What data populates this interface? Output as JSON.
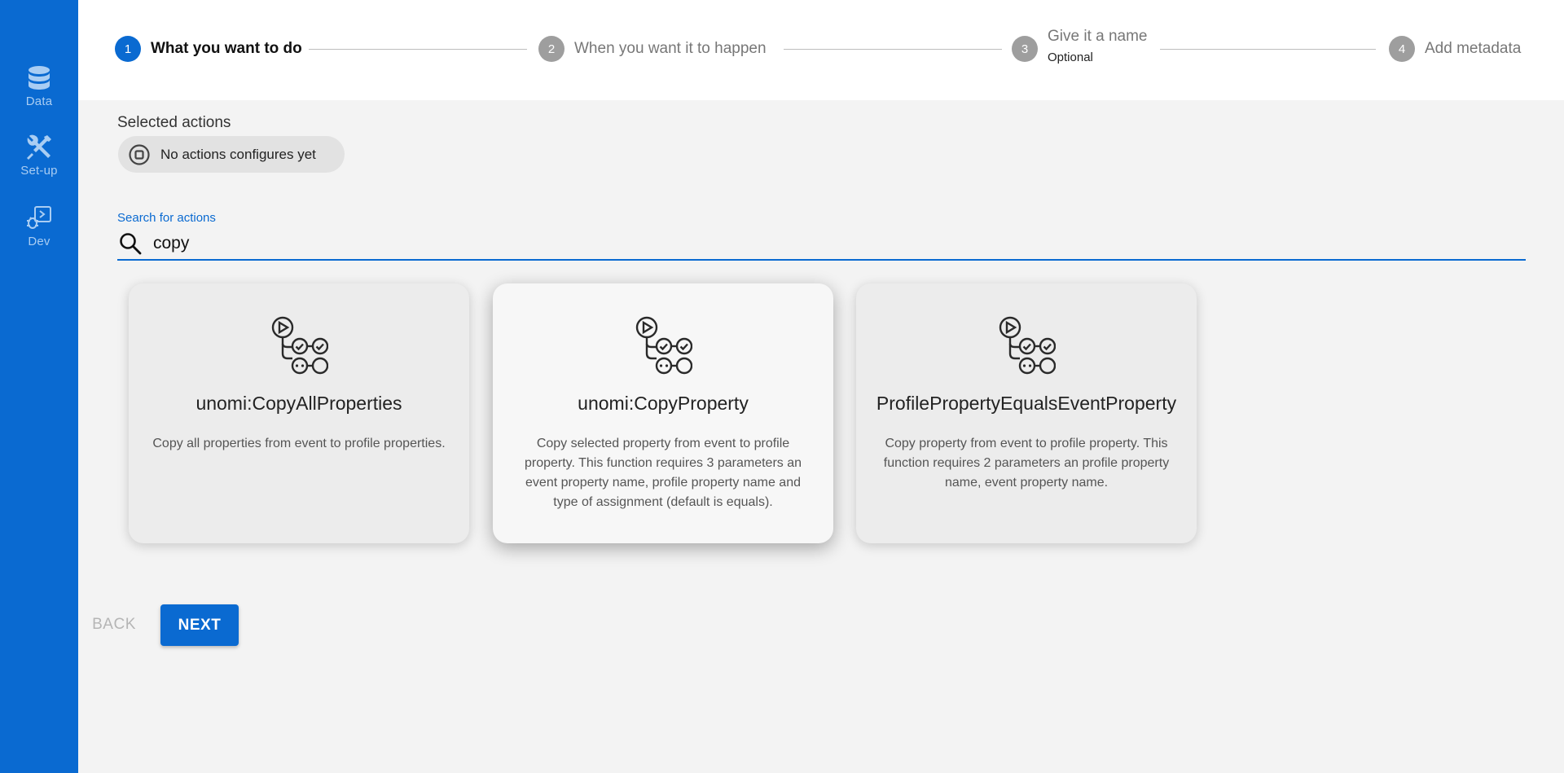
{
  "sidebar": {
    "items": [
      {
        "label": "Data",
        "icon": "database-icon"
      },
      {
        "label": "Set-up",
        "icon": "tools-icon"
      },
      {
        "label": "Dev",
        "icon": "dev-icon"
      }
    ]
  },
  "stepper": {
    "steps": [
      {
        "number": "1",
        "label": "What you want to do",
        "sublabel": "",
        "active": true
      },
      {
        "number": "2",
        "label": "When you want it to happen",
        "sublabel": "",
        "active": false
      },
      {
        "number": "3",
        "label": "Give it a name",
        "sublabel": "Optional",
        "active": false
      },
      {
        "number": "4",
        "label": "Add metadata",
        "sublabel": "",
        "active": false
      }
    ]
  },
  "selected_actions": {
    "title": "Selected actions",
    "empty_chip": "No actions configures yet"
  },
  "search": {
    "label": "Search for actions",
    "value": "copy"
  },
  "cards": [
    {
      "title": "unomi:CopyAllProperties",
      "description": "Copy all properties from event to profile properties.",
      "icon": "workflow-icon"
    },
    {
      "title": "unomi:CopyProperty",
      "description": "Copy selected property from event to profile property. This function requires 3 parameters an event property name, profile property name and type of assignment (default is equals).",
      "icon": "workflow-icon"
    },
    {
      "title": "ProfilePropertyEqualsEventProperty",
      "description": "Copy property from event to profile property. This function requires 2 parameters an profile property name, event property name.",
      "icon": "workflow-icon"
    }
  ],
  "buttons": {
    "back": "BACK",
    "next": "NEXT"
  },
  "colors": {
    "primary": "#0a6ad1",
    "sidebar_label": "#a9cdf3",
    "inactive_step": "#9e9e9e"
  }
}
